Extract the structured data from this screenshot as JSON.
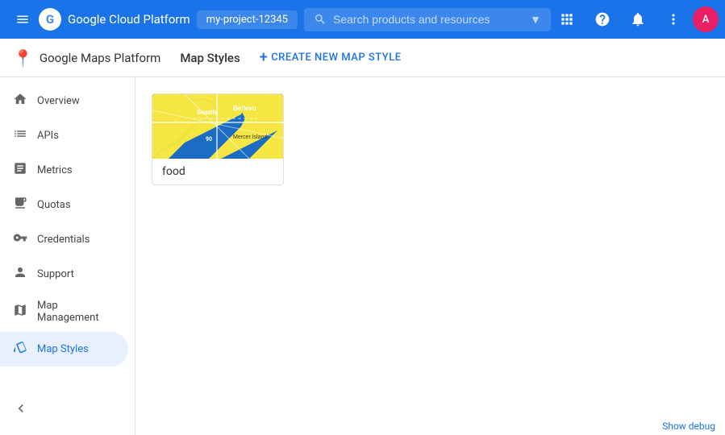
{
  "header": {
    "menu_icon": "≡",
    "app_title": "Google Cloud Platform",
    "project_name": "my-project-12345",
    "search_placeholder": "Search products and resources",
    "icons": {
      "grid": "⊞",
      "help": "?",
      "bell": "🔔",
      "more": "⋮"
    },
    "avatar_initial": "A"
  },
  "sub_header": {
    "app_name": "Google Maps Platform",
    "page_title": "Map Styles",
    "create_button": "CREATE NEW MAP STYLE"
  },
  "sidebar": {
    "items": [
      {
        "id": "overview",
        "label": "Overview",
        "icon": "home"
      },
      {
        "id": "apis",
        "label": "APIs",
        "icon": "list"
      },
      {
        "id": "metrics",
        "label": "Metrics",
        "icon": "bar_chart"
      },
      {
        "id": "quotas",
        "label": "Quotas",
        "icon": "monitor"
      },
      {
        "id": "credentials",
        "label": "Credentials",
        "icon": "vpn_key"
      },
      {
        "id": "support",
        "label": "Support",
        "icon": "person"
      },
      {
        "id": "map_management",
        "label": "Map Management",
        "icon": "layers"
      },
      {
        "id": "map_styles",
        "label": "Map Styles",
        "icon": "style",
        "active": true
      }
    ]
  },
  "map_styles": {
    "cards": [
      {
        "id": "food",
        "label": "food"
      }
    ]
  },
  "footer": {
    "debug_label": "Show debug"
  }
}
